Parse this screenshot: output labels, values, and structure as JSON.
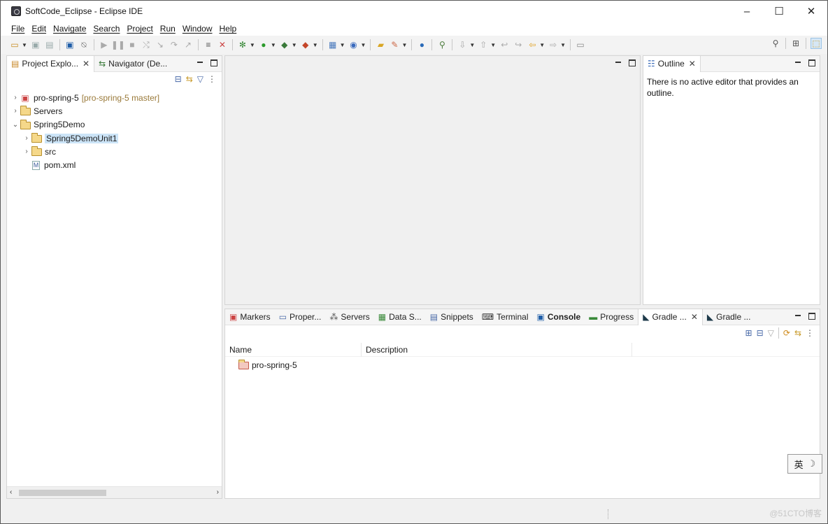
{
  "window": {
    "title": "SoftCode_Eclipse - Eclipse IDE",
    "controls": {
      "minimize": "–",
      "maximize": "☐",
      "close": "✕"
    }
  },
  "menu": [
    "File",
    "Edit",
    "Navigate",
    "Search",
    "Project",
    "Run",
    "Window",
    "Help"
  ],
  "explorer": {
    "tabs": [
      {
        "label": "Project Explo...",
        "close": "✕"
      },
      {
        "label": "Navigator (De..."
      }
    ],
    "tree": [
      {
        "name": "pro-spring-5",
        "extra": "[pro-spring-5 master]",
        "twisty": "›",
        "icon": "project-icon"
      },
      {
        "name": "Servers",
        "twisty": "›",
        "icon": "folder-icon"
      },
      {
        "name": "Spring5Demo",
        "twisty": "⌄",
        "icon": "project-icon"
      },
      {
        "name": "Spring5DemoUnit1",
        "twisty": "›",
        "icon": "project-icon",
        "selected": true
      },
      {
        "name": "src",
        "twisty": "›",
        "icon": "folder-icon"
      },
      {
        "name": "pom.xml",
        "twisty": "",
        "icon": "maven-file-icon"
      }
    ]
  },
  "outline": {
    "tab_label": "Outline",
    "message": "There is no active editor that provides an outline."
  },
  "bottom": {
    "tabs": [
      {
        "label": "Markers",
        "icon": "markers-icon"
      },
      {
        "label": "Proper...",
        "icon": "properties-icon"
      },
      {
        "label": "Servers",
        "icon": "servers-icon"
      },
      {
        "label": "Data S...",
        "icon": "data-source-icon"
      },
      {
        "label": "Snippets",
        "icon": "snippets-icon"
      },
      {
        "label": "Terminal",
        "icon": "terminal-icon"
      },
      {
        "label": "Console",
        "icon": "console-icon",
        "bold": true
      },
      {
        "label": "Progress",
        "icon": "progress-icon"
      },
      {
        "label": "Gradle ...",
        "icon": "gradle-icon",
        "close": "✕"
      },
      {
        "label": "Gradle ...",
        "icon": "gradle-icon"
      }
    ],
    "columns": [
      "Name",
      "Description"
    ],
    "rows": [
      {
        "name": "pro-spring-5",
        "description": ""
      }
    ]
  },
  "ime": {
    "lang": "英",
    "mode": "☽"
  },
  "watermark": "@51CTO博客",
  "colors": {
    "selection": "#cce4f7",
    "panel_border": "#d5d5d5",
    "window_bg": "#f0f0f0"
  }
}
